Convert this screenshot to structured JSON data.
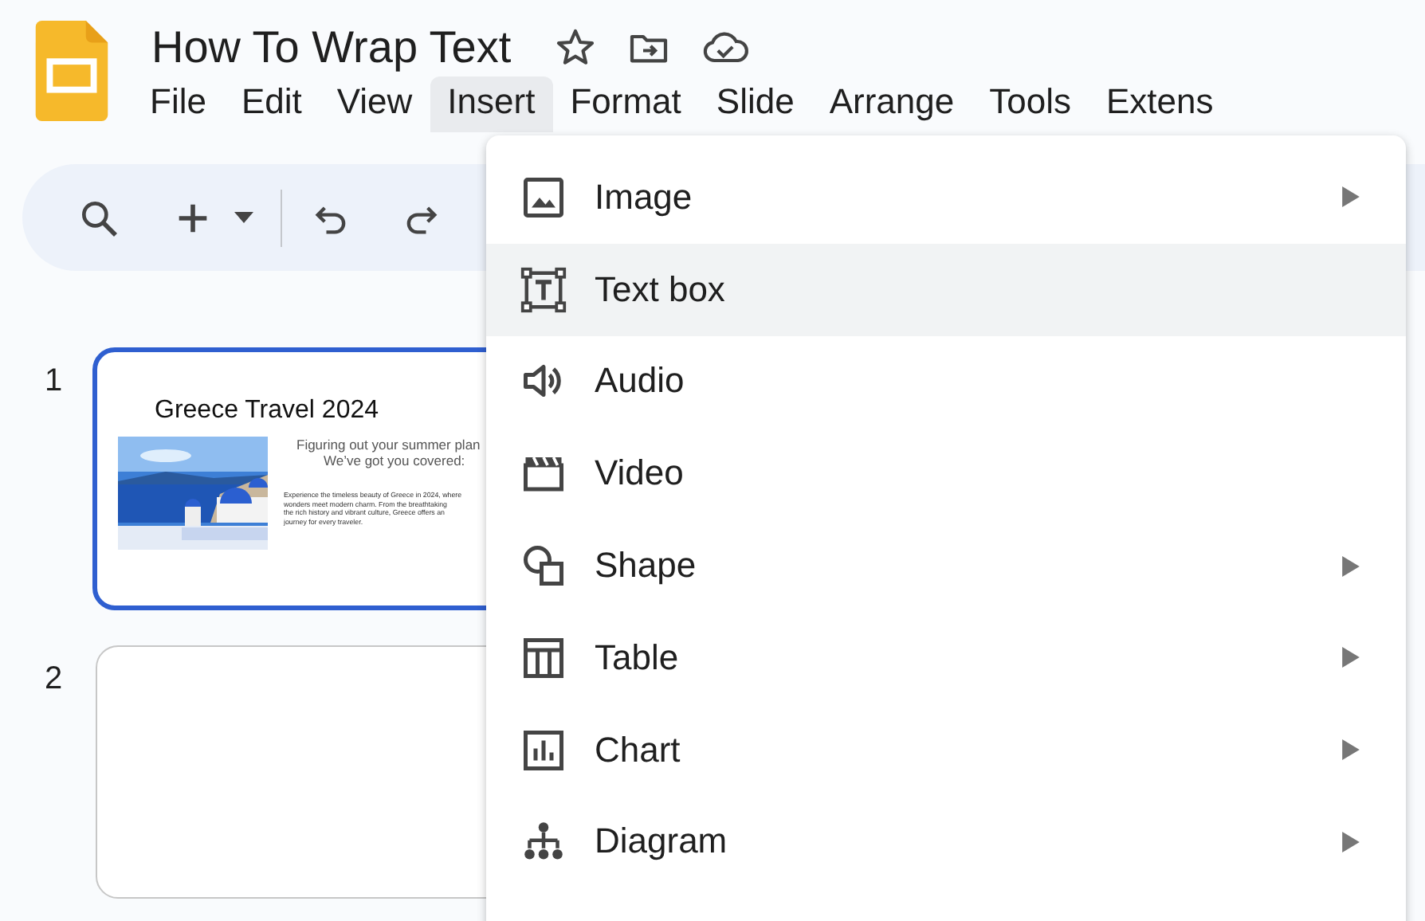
{
  "document": {
    "title": "How To Wrap Text"
  },
  "menubar": [
    {
      "label": "File",
      "selected": false
    },
    {
      "label": "Edit",
      "selected": false
    },
    {
      "label": "View",
      "selected": false
    },
    {
      "label": "Insert",
      "selected": true
    },
    {
      "label": "Format",
      "selected": false
    },
    {
      "label": "Slide",
      "selected": false
    },
    {
      "label": "Arrange",
      "selected": false
    },
    {
      "label": "Tools",
      "selected": false
    },
    {
      "label": "Extens",
      "selected": false
    }
  ],
  "slides": [
    {
      "number": "1",
      "selected": true,
      "title": "Greece Travel 2024",
      "subtitle": [
        "Figuring out your summer plan",
        "We’ve got you covered:"
      ],
      "body": [
        "Experience the timeless beauty of Greece in 2024, where",
        "wonders meet modern charm. From the breathtaking",
        "the rich history and vibrant culture, Greece offers an",
        "journey for every traveler."
      ]
    },
    {
      "number": "2",
      "selected": false
    }
  ],
  "insert_menu": [
    {
      "label": "Image",
      "selected": false,
      "submenu": true
    },
    {
      "label": "Text box",
      "selected": true,
      "submenu": false
    },
    {
      "label": "Audio",
      "selected": false,
      "submenu": false
    },
    {
      "label": "Video",
      "selected": false,
      "submenu": false
    },
    {
      "label": "Shape",
      "selected": false,
      "submenu": true
    },
    {
      "label": "Table",
      "selected": false,
      "submenu": true
    },
    {
      "label": "Chart",
      "selected": false,
      "submenu": true
    },
    {
      "label": "Diagram",
      "selected": false,
      "submenu": true
    }
  ]
}
